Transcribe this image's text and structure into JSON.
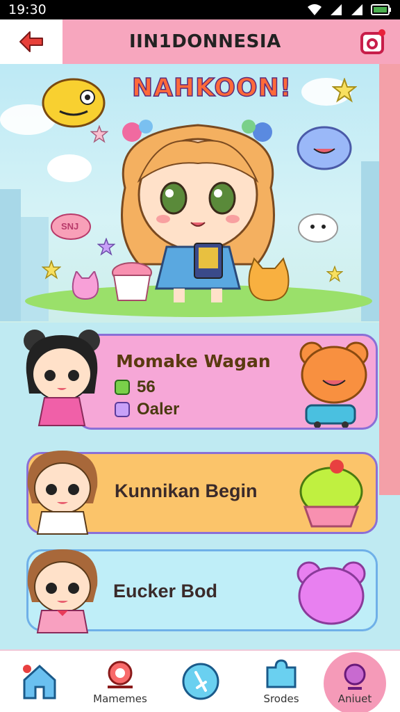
{
  "status_bar": {
    "time": "19:30"
  },
  "header": {
    "title": "IIN1DONNESIA"
  },
  "hero": {
    "title": "NAHKOON!",
    "bubble_text": "SNJ"
  },
  "cards": [
    {
      "name": "Momake Wagan",
      "stat1": "56",
      "stat2": "Oaler"
    },
    {
      "name": "Kunnikan Begin"
    },
    {
      "name": "Eucker Bod"
    }
  ],
  "bottom_nav": {
    "items": [
      {
        "label": ""
      },
      {
        "label": "Mamemes"
      },
      {
        "label": ""
      },
      {
        "label": "Srodes"
      },
      {
        "label": "Aniuet"
      }
    ]
  },
  "colors": {
    "header_pink": "#f7a6be",
    "card1": "#f6a7d7",
    "card2": "#fbc46a",
    "card3": "#bfeef8",
    "accent_purple": "#8a6fd6"
  }
}
